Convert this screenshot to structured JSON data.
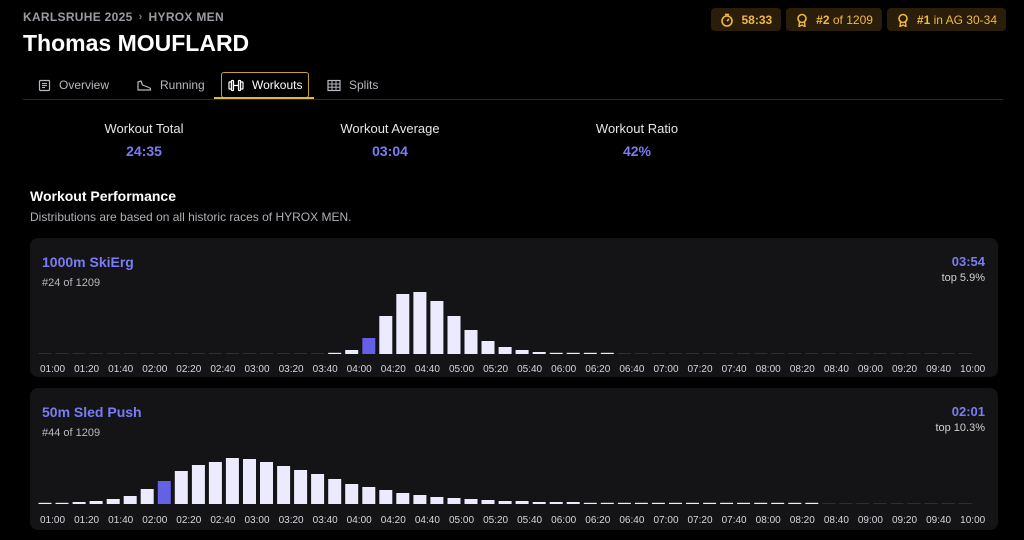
{
  "breadcrumb": {
    "event": "KARLSRUHE 2025",
    "separator": "›",
    "division": "HYROX MEN"
  },
  "athlete": {
    "name": "Thomas MOUFLARD"
  },
  "badges": {
    "time": "58:33",
    "overall_rank": "#2",
    "overall_of": "of 1209",
    "ag_rank": "#1",
    "ag_label": "in AG 30-34"
  },
  "tabs": [
    {
      "label": "Overview",
      "icon": "document-icon"
    },
    {
      "label": "Running",
      "icon": "shoe-icon"
    },
    {
      "label": "Workouts",
      "icon": "dumbbell-icon",
      "active": true
    },
    {
      "label": "Splits",
      "icon": "table-icon"
    }
  ],
  "stats": [
    {
      "label": "Workout Total",
      "value": "24:35"
    },
    {
      "label": "Workout Average",
      "value": "03:04"
    },
    {
      "label": "Workout Ratio",
      "value": "42%"
    }
  ],
  "section": {
    "title": "Workout Performance",
    "subtitle": "Distributions are based on all historic races of HYROX MEN."
  },
  "colors": {
    "accent": "#7a7cf5",
    "bar": "#ecebfd",
    "highlight": "#6461e6",
    "gold": "#f2b93b"
  },
  "chart_data": [
    {
      "type": "bar",
      "title": "1000m SkiErg",
      "rank_text": "#24 of 1209",
      "athlete_time": "03:54",
      "top_text": "top 5.9%",
      "tick_labels": [
        "01:00",
        "01:20",
        "01:40",
        "02:00",
        "02:20",
        "02:40",
        "03:00",
        "03:20",
        "03:40",
        "04:00",
        "04:20",
        "04:40",
        "05:00",
        "05:20",
        "05:40",
        "06:00",
        "06:20",
        "06:40",
        "07:00",
        "07:20",
        "07:40",
        "08:00",
        "08:20",
        "08:40",
        "09:00",
        "09:20",
        "09:40",
        "10:00"
      ],
      "values": [
        0,
        0,
        0,
        0,
        0,
        0,
        0,
        0,
        0,
        0,
        0,
        0,
        0,
        0,
        0,
        0,
        0,
        1,
        4,
        16,
        38,
        60,
        62,
        53,
        38,
        24,
        13,
        7,
        4,
        2,
        1,
        1,
        1,
        1,
        0,
        0,
        0,
        0,
        0,
        0,
        0,
        0,
        0,
        0,
        0,
        0,
        0,
        0,
        0,
        0,
        0,
        0,
        0,
        0,
        0
      ],
      "highlight_index": 19,
      "ylim": [
        0,
        62
      ]
    },
    {
      "type": "bar",
      "title": "50m Sled Push",
      "rank_text": "#44 of 1209",
      "athlete_time": "02:01",
      "top_text": "top 10.3%",
      "tick_labels": [
        "01:00",
        "01:20",
        "01:40",
        "02:00",
        "02:20",
        "02:40",
        "03:00",
        "03:20",
        "03:40",
        "04:00",
        "04:20",
        "04:40",
        "05:00",
        "05:20",
        "05:40",
        "06:00",
        "06:20",
        "06:40",
        "07:00",
        "07:20",
        "07:40",
        "08:00",
        "08:20",
        "08:40",
        "09:00",
        "09:20",
        "09:40",
        "10:00"
      ],
      "values": [
        1,
        1,
        2,
        3,
        5,
        8,
        15,
        23,
        33,
        39,
        42,
        46,
        45,
        42,
        38,
        34,
        30,
        25,
        20,
        17,
        14,
        11,
        9,
        7,
        6,
        5,
        4,
        3,
        3,
        2,
        2,
        2,
        1,
        1,
        1,
        1,
        1,
        1,
        1,
        1,
        1,
        1,
        1,
        1,
        1,
        1,
        0,
        0,
        0,
        0,
        0,
        0,
        0,
        0,
        0
      ],
      "highlight_index": 7,
      "ylim": [
        0,
        46
      ]
    }
  ]
}
